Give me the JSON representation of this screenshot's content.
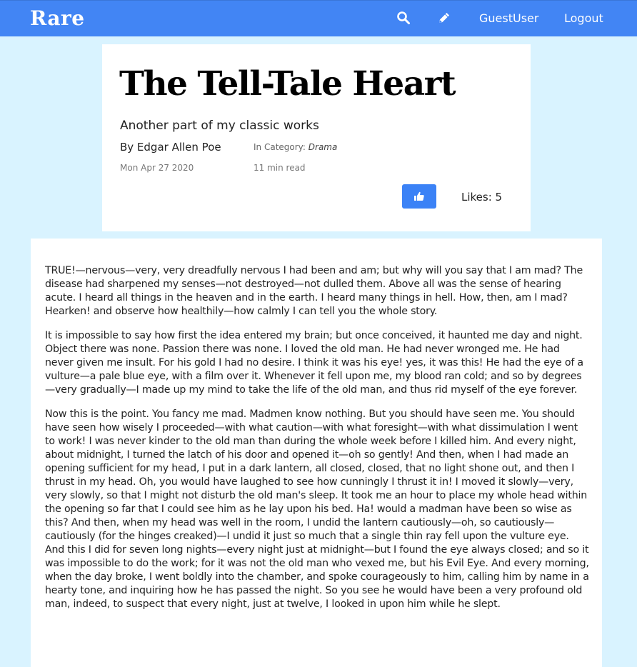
{
  "navbar": {
    "brand": "Rare",
    "search_icon": "search-icon",
    "edit_icon": "pencil-icon",
    "user_label": "GuestUser",
    "logout_label": "Logout",
    "background_color": "#4285f4"
  },
  "post": {
    "title": "The Tell-Tale Heart",
    "subtitle": "Another part of my classic works",
    "author": "By Edgar Allen Poe",
    "category_label": "In Category:",
    "category_value": "Drama",
    "date": "Mon Apr 27 2020",
    "read_time": "11 min read",
    "like_icon": "thumbs-up-icon",
    "likes_label": "Likes: 5",
    "paragraphs": [
      "TRUE!—nervous—very, very dreadfully nervous I had been and am; but why will you say that I am mad? The disease had sharpened my senses—not destroyed—not dulled them. Above all was the sense of hearing acute. I heard all things in the heaven and in the earth. I heard many things in hell. How, then, am I mad? Hearken! and observe how healthily—how calmly I can tell you the whole story.",
      "It is impossible to say how first the idea entered my brain; but once conceived, it haunted me day and night. Object there was none. Passion there was none. I loved the old man. He had never wronged me. He had never given me insult. For his gold I had no desire. I think it was his eye! yes, it was this! He had the eye of a vulture—a pale blue eye, with a film over it. Whenever it fell upon me, my blood ran cold; and so by degrees—very gradually—I made up my mind to take the life of the old man, and thus rid myself of the eye forever.",
      "Now this is the point. You fancy me mad. Madmen know nothing. But you should have seen me. You should have seen how wisely I proceeded—with what caution—with what foresight—with what dissimulation I went to work! I was never kinder to the old man than during the whole week before I killed him. And every night, about midnight, I turned the latch of his door and opened it—oh so gently! And then, when I had made an opening sufficient for my head, I put in a dark lantern, all closed, closed, that no light shone out, and then I thrust in my head. Oh, you would have laughed to see how cunningly I thrust it in! I moved it slowly—very, very slowly, so that I might not disturb the old man's sleep. It took me an hour to place my whole head within the opening so far that I could see him as he lay upon his bed. Ha! would a madman have been so wise as this? And then, when my head was well in the room, I undid the lantern cautiously—oh, so cautiously—cautiously (for the hinges creaked)—I undid it just so much that a single thin ray fell upon the vulture eye. And this I did for seven long nights—every night just at midnight—but I found the eye always closed; and so it was impossible to do the work; for it was not the old man who vexed me, but his Evil Eye. And every morning, when the day broke, I went boldly into the chamber, and spoke courageously to him, calling him by name in a hearty tone, and inquiring how he has passed the night. So you see he would have been a very profound old man, indeed, to suspect that every night, just at twelve, I looked in upon him while he slept."
    ]
  },
  "colors": {
    "page_background": "#d9f3ff",
    "card_background": "#ffffff",
    "accent": "#3b82f6"
  }
}
